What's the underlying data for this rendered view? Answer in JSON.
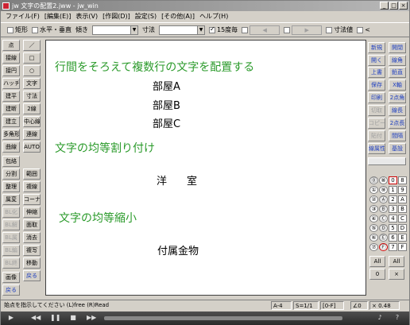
{
  "window": {
    "title": "jw 文字の配置2.jww - jw_win",
    "controls": [
      "_",
      "□",
      "×"
    ]
  },
  "menu": [
    "ファイル(F)",
    "[編集(E)]",
    "表示(V)",
    "[作図(D)]",
    "設定(S)",
    "[その他(A)]",
    "ヘルプ(H)"
  ],
  "toolbar": {
    "rect_label": "矩形",
    "horiz_label": "水平・垂直",
    "angle_label": "傾き",
    "dim_label": "寸法",
    "scale_label": "15度毎",
    "disabled_btn": "◀",
    "disabled_btn2": "▶",
    "fix_label": "寸法値",
    "lt_label": "<"
  },
  "left_buttons": [
    [
      "点",
      "／"
    ],
    [
      "接線",
      "□"
    ],
    [
      "接円",
      "○"
    ],
    [
      "ハッチ",
      "文字"
    ],
    [
      "建平",
      "寸法"
    ],
    [
      "建断",
      "2線"
    ],
    [
      "建立",
      "中心線"
    ],
    [
      "多角形",
      "連線"
    ],
    [
      "曲線",
      "AUTO"
    ],
    [
      "包絡",
      ""
    ],
    [
      "分割",
      "範囲"
    ],
    [
      "整理",
      "複線"
    ],
    [
      "属変",
      "コーナー"
    ],
    [
      "BL化",
      "伸縮"
    ],
    [
      "BL解",
      "面取"
    ],
    [
      "BL属",
      "消去"
    ],
    [
      "BL編",
      "複写"
    ],
    [
      "BL終",
      "移動"
    ],
    [
      "画像",
      "戻る"
    ],
    [
      "戻る",
      ""
    ]
  ],
  "canvas": {
    "heading1": "行間をそろえて複数行の文字を配置する",
    "rooms": [
      "部屋A",
      "部屋B",
      "部屋C"
    ],
    "heading2": "文字の均等割り付け",
    "spread_text": "洋　室",
    "heading3": "文字の均等縮小",
    "shrink_text": "付属金物"
  },
  "right_buttons": [
    [
      "新規",
      "開閉"
    ],
    [
      "開く",
      "線角"
    ],
    [
      "上書",
      "鉛直"
    ],
    [
      "保存",
      "X軸"
    ],
    [
      "印刷",
      "2点角"
    ],
    [
      "切取",
      "線長"
    ],
    [
      "コピー",
      "2点長"
    ],
    [
      "貼付",
      "間隔"
    ],
    [
      "線属性",
      "基設"
    ]
  ],
  "layer_buttons": [
    [
      "⓪",
      "⑧",
      "0",
      "8"
    ],
    [
      "①",
      "⑨",
      "1",
      "9"
    ],
    [
      "②",
      "Ⓐ",
      "2",
      "A"
    ],
    [
      "③",
      "Ⓑ",
      "3",
      "B"
    ],
    [
      "④",
      "Ⓒ",
      "4",
      "C"
    ],
    [
      "⑤",
      "Ⓓ",
      "5",
      "D"
    ],
    [
      "⑥",
      "Ⓔ",
      "6",
      "E"
    ],
    [
      "⑦",
      "Ⓕ",
      "7",
      "F"
    ]
  ],
  "layer_extra": {
    "all1": "All",
    "all2": "All",
    "zero": "0",
    "x": "×"
  },
  "status": {
    "message": "始点を指示してください (L)free (R)Read",
    "paper": "A-4",
    "scale": "S=1/1",
    "layer": "[0-F]",
    "angle": "∠0",
    "zoom": "× 0.48"
  }
}
